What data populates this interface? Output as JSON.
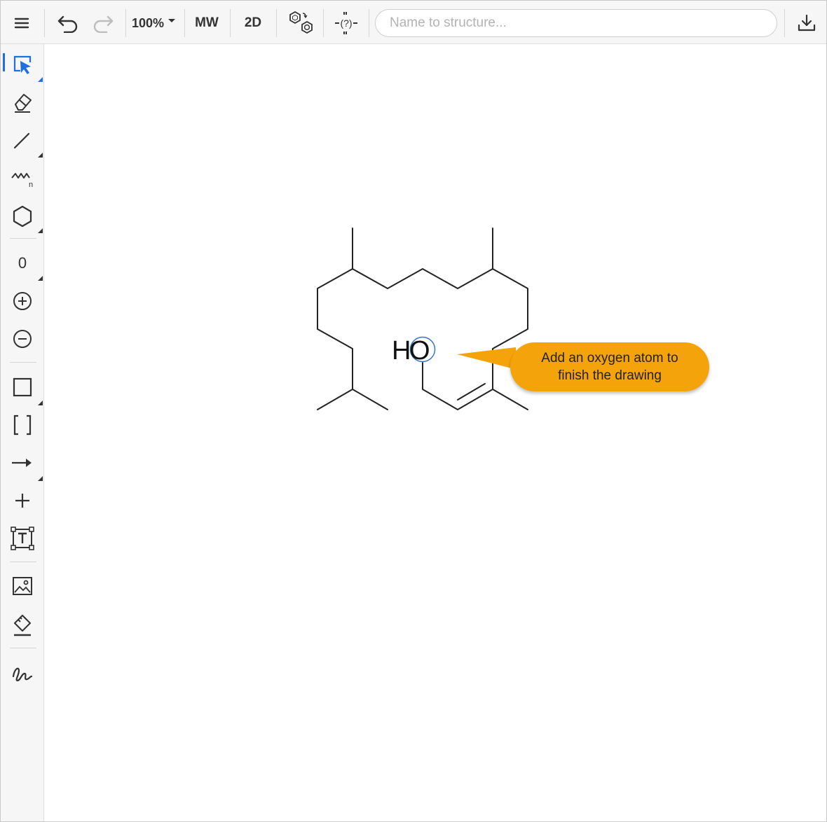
{
  "toolbar": {
    "zoom": "100%",
    "mw_label": "MW",
    "dim_label": "2D",
    "search_placeholder": "Name to structure..."
  },
  "left_tools": {
    "charge_label": "0"
  },
  "molecule": {
    "atom_label_h": "H",
    "atom_label_o": "O"
  },
  "tooltip": {
    "text": "Add an oxygen atom to finish the drawing",
    "color": "#f5a30a"
  },
  "colors": {
    "accent": "#1f6fe0",
    "bond": "#222222",
    "toolbar_bg": "#f6f6f6"
  }
}
